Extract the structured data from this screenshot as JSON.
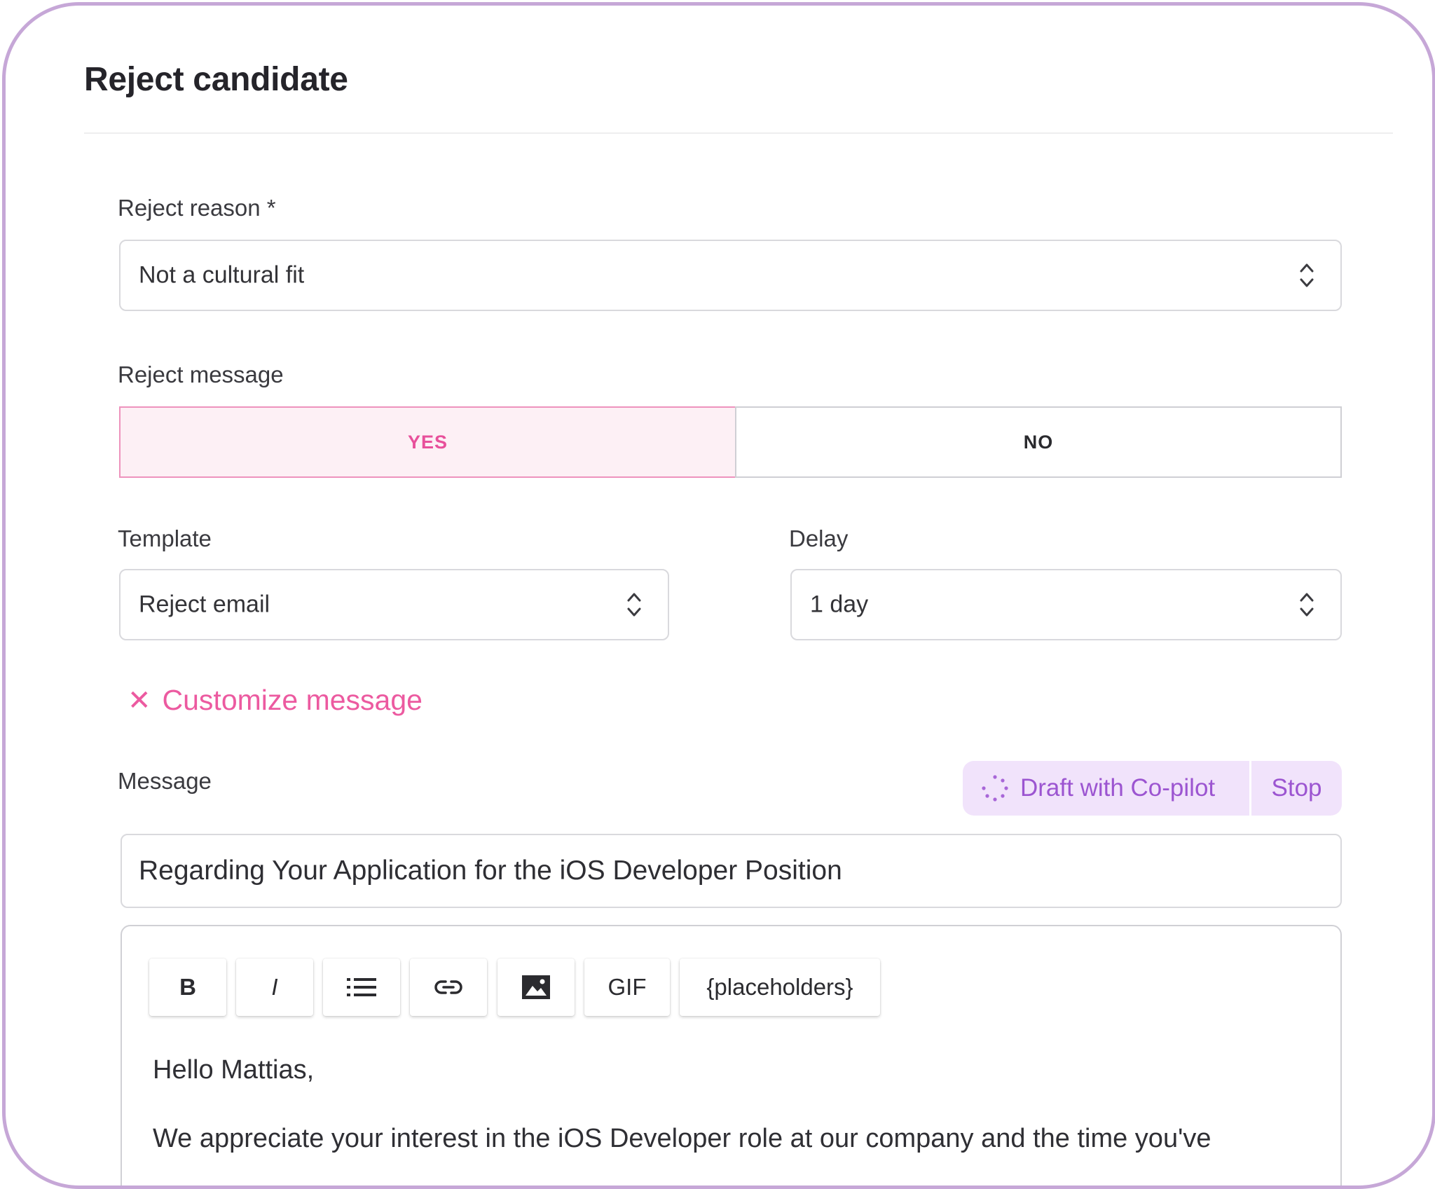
{
  "dialog": {
    "title": "Reject candidate"
  },
  "reject_reason": {
    "label": "Reject reason *",
    "value": "Not a cultural fit",
    "icon": "chevron-up-down-icon"
  },
  "reject_message": {
    "label": "Reject message",
    "yes_label": "YES",
    "no_label": "NO",
    "selected": "YES"
  },
  "template": {
    "label": "Template",
    "value": "Reject email"
  },
  "delay": {
    "label": "Delay",
    "value": "1 day"
  },
  "customize": {
    "label": "Customize message",
    "icon": "close-icon"
  },
  "message": {
    "label": "Message",
    "copilot_label": "Draft with Co-pilot",
    "stop_label": "Stop",
    "subject": "Regarding Your Application for the iOS Developer Position",
    "toolbar": {
      "bold": "B",
      "italic": "I",
      "list_icon": "list-icon",
      "link_icon": "link-icon",
      "image_icon": "image-icon",
      "gif": "GIF",
      "placeholders": "{placeholders}"
    },
    "body": [
      "Hello Mattias,",
      "We appreciate your interest in the iOS Developer role at our company and the time you've"
    ]
  },
  "colors": {
    "accent_pink": "#e8509b",
    "accent_purple": "#9c55d1",
    "frame_border": "#c6a7d7"
  }
}
